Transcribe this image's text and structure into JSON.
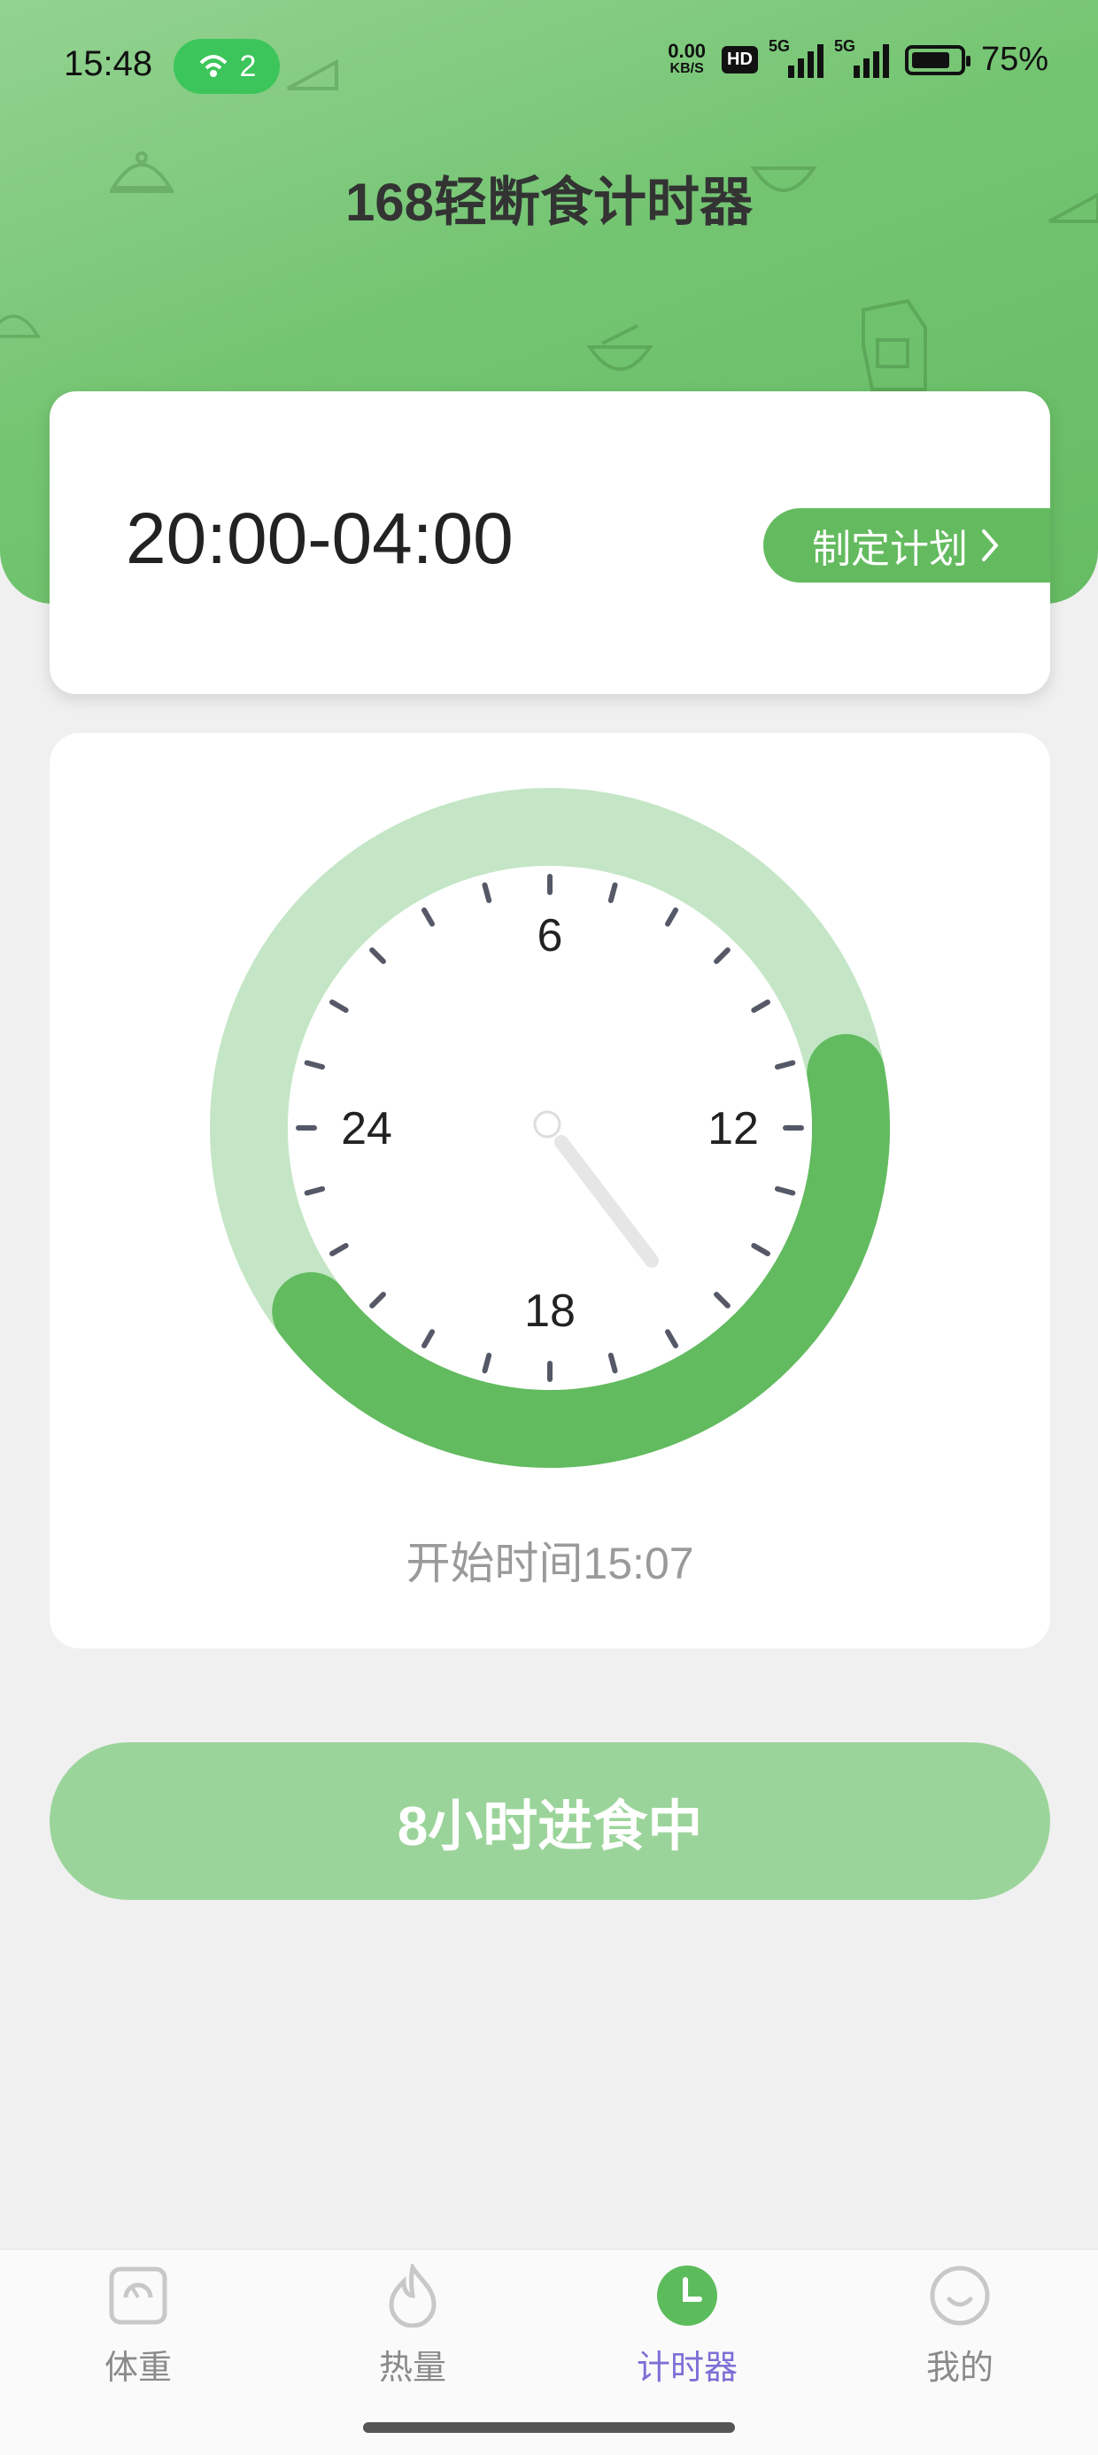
{
  "status_bar": {
    "time": "15:48",
    "hotspot_count": "2",
    "net_speed_top": "0.00",
    "net_speed_unit": "KB/S",
    "hd_label": "HD",
    "signal_1_label": "5G",
    "signal_2_label": "5G",
    "battery_percent": "75%"
  },
  "header": {
    "title": "168轻断食计时器"
  },
  "plan_card": {
    "time_range": "20:00-04:00",
    "plan_button_label": "制定计划",
    "plan_button_icon": "chevron-right-icon"
  },
  "clock": {
    "labels": {
      "top": "6",
      "right": "12",
      "bottom": "18",
      "left": "24"
    },
    "start_time_text": "开始时间15:07",
    "ring_color": "#c4e6c6",
    "arc_color": "#62bb5f",
    "eating_arc_start_hour": 21.5,
    "eating_arc_end_hour": 11.3
  },
  "status_button": {
    "label": "8小时进食中"
  },
  "tabs": [
    {
      "label": "体重",
      "icon": "scale-icon",
      "active": false
    },
    {
      "label": "热量",
      "icon": "flame-icon",
      "active": false
    },
    {
      "label": "计时器",
      "icon": "clock-icon",
      "active": true
    },
    {
      "label": "我的",
      "icon": "smile-icon",
      "active": false
    }
  ],
  "colors": {
    "accent_green": "#64bb5f",
    "active_tab": "#7c6fd6"
  }
}
